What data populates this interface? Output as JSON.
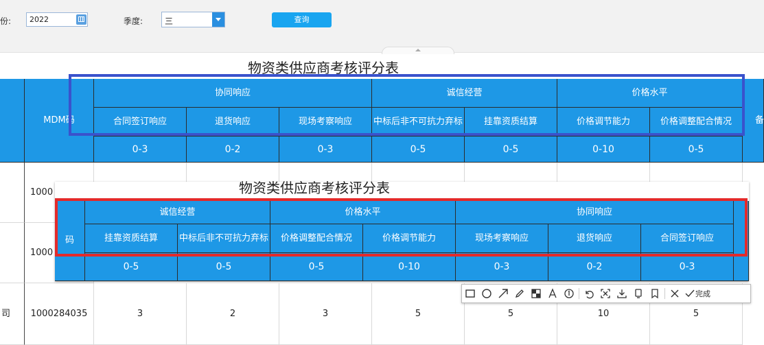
{
  "filters": {
    "year_label": "份:",
    "year_value": "2022",
    "season_label": "季度:",
    "season_value": "三",
    "query_label": "查询"
  },
  "report": {
    "title": "物资类供应商考核评分表",
    "mdm_header": "MDM码",
    "partial_right_header": "备",
    "groups": [
      "协同响应",
      "诚信经营",
      "价格水平"
    ],
    "columns": [
      "合同签订响应",
      "退货响应",
      "现场考察响应",
      "中标后非不可抗力弃标",
      "挂靠资质结算",
      "价格调节能力",
      "价格调整配合情况"
    ],
    "ranges": [
      "0-3",
      "0-2",
      "0-3",
      "0-5",
      "0-5",
      "0-10",
      "0-5"
    ],
    "rows": [
      {
        "left": "",
        "code": "1000",
        "scores": [
          "",
          "",
          "",
          "",
          "",
          "",
          ""
        ]
      },
      {
        "left": "",
        "code": "1000",
        "scores": [
          "",
          "",
          "",
          "",
          "",
          "",
          ""
        ]
      },
      {
        "left": "司",
        "code": "1000284035",
        "scores": [
          "3",
          "2",
          "3",
          "5",
          "5",
          "10",
          "5"
        ]
      }
    ]
  },
  "overlay": {
    "title": "物资类供应商考核评分表",
    "code_header": "码",
    "groups": [
      "诚信经营",
      "价格水平",
      "协同响应"
    ],
    "columns": [
      "挂靠资质结算",
      "中标后非不可抗力弃标",
      "价格调整配合情况",
      "价格调节能力",
      "现场考察响应",
      "退货响应",
      "合同签订响应"
    ],
    "ranges": [
      "0-5",
      "0-5",
      "0-5",
      "0-10",
      "0-3",
      "0-2",
      "0-3"
    ]
  },
  "toolbar": {
    "done_label": "完成",
    "tools": [
      "rectangle-icon",
      "ellipse-icon",
      "arrow-icon",
      "pencil-icon",
      "mosaic-icon",
      "text-icon",
      "number-icon",
      "undo-icon",
      "crop-icon",
      "download-icon",
      "pin-icon",
      "bookmark-icon",
      "close-icon",
      "check-icon"
    ]
  },
  "colors": {
    "header_blue": "#1e98e6",
    "highlight_blue": "#3a52cc",
    "highlight_red": "#e42a2a",
    "query_button": "#19a5f0"
  }
}
